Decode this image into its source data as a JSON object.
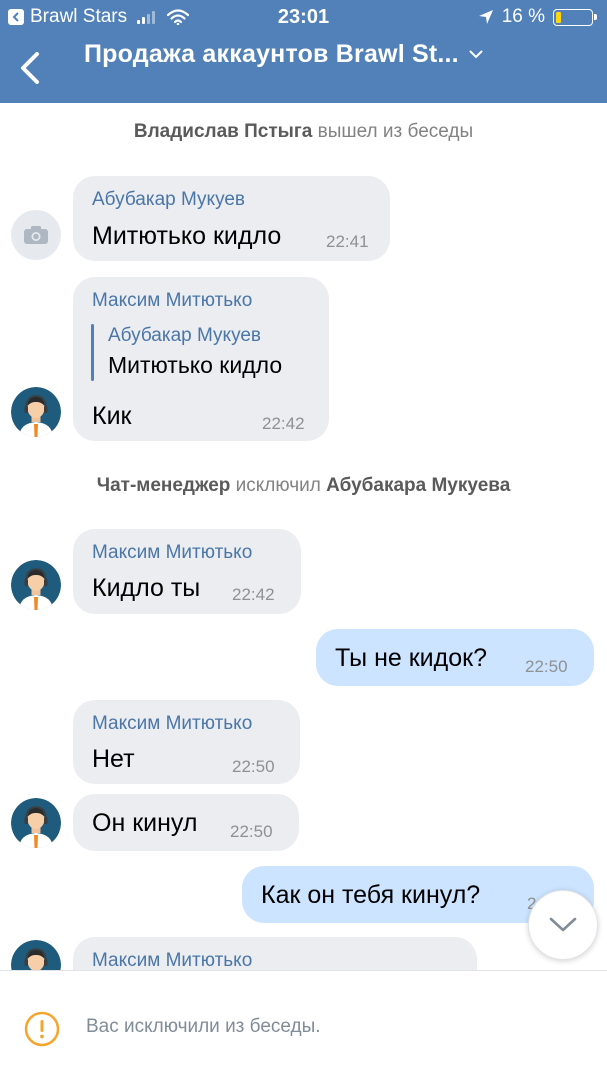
{
  "status_bar": {
    "back_app": "Brawl Stars",
    "time": "23:01",
    "battery": "16 %",
    "battery_level": 0.16
  },
  "nav": {
    "title": "Продажа аккаунтов Brawl St..."
  },
  "system": {
    "left_name": "Владислав Пстыга",
    "left_action": "вышел из беседы",
    "kick_actor": "Чат-менеджер",
    "kick_action": "исключил",
    "kick_target": "Абубакара Мукуева"
  },
  "messages": [
    {
      "sender": "Абубакар Мукуев",
      "text": "Митютько кидло",
      "time": "22:41"
    },
    {
      "sender": "Максим Митютько",
      "quote_sender": "Абубакар Мукуев",
      "quote_text": "Митютько кидло",
      "text": "Кик",
      "time": "22:42"
    },
    {
      "sender": "Максим Митютько",
      "text": "Кидло ты",
      "time": "22:42"
    },
    {
      "text": "Ты не кидок?",
      "time": "22:50"
    },
    {
      "sender": "Максим Митютько",
      "text": "Нет",
      "time": "22:50"
    },
    {
      "text": "Он кинул",
      "time": "22:50"
    },
    {
      "text": "Как он тебя кинул?",
      "time": "2"
    },
    {
      "sender": "Максим Митютько"
    }
  ],
  "footer": {
    "notice": "Вас исключили из беседы."
  },
  "colors": {
    "header": "#5181b8",
    "incoming_bubble": "#ebedf0",
    "outgoing_bubble": "#cce4ff",
    "sender_name": "#4a76a8",
    "warning": "#f4a52c"
  }
}
